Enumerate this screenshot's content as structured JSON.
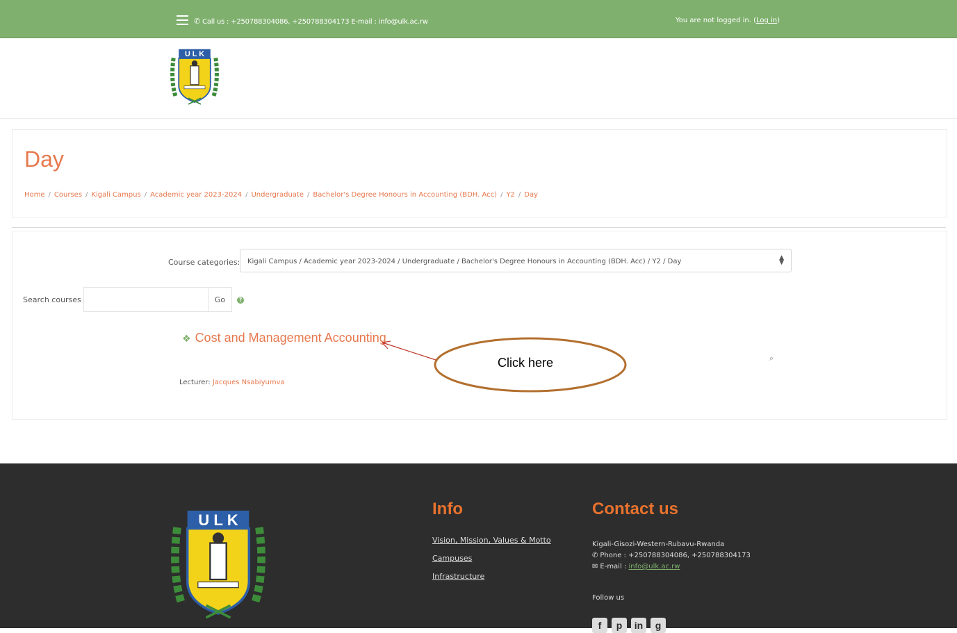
{
  "topbar": {
    "contact_text": "Call us : +250788304086, +250788304173 E-mail : info@ulk.ac.rw",
    "login_text": "You are not logged in. (",
    "login_link": "Log in",
    "login_close": ")"
  },
  "logo": {
    "letters": "U L K"
  },
  "page": {
    "title": "Day",
    "breadcrumb": [
      "Home",
      "Courses",
      "Kigali Campus",
      "Academic year 2023-2024",
      "Undergraduate",
      "Bachelor's Degree Honours in Accounting (BDH. Acc)",
      "Y2",
      "Day"
    ]
  },
  "filters": {
    "category_label": "Course categories:",
    "category_selected": "Kigali Campus / Academic year 2023-2024 / Undergraduate / Bachelor's Degree Honours in Accounting (BDH. Acc) / Y2 / Day",
    "search_label": "Search courses",
    "search_value": "",
    "go_label": "Go"
  },
  "course": {
    "name": "Cost and Management Accounting",
    "lecturer_label": "Lecturer:",
    "lecturer_name": "Jacques Nsabiyumva"
  },
  "annotation": {
    "text": "Click here"
  },
  "footer": {
    "info_title": "Info",
    "info_links": [
      "Vision, Mission, Values & Motto",
      "Campuses",
      "Infrastructure"
    ],
    "contact_title": "Contact us",
    "address": "Kigali-Gisozi-Western-Rubavu-Rwanda",
    "phone_label": "Phone : ",
    "phone": "+250788304086, +250788304173",
    "email_label": "E-mail : ",
    "email": "info@ulk.ac.rw",
    "follow_label": "Follow us"
  },
  "colors": {
    "accent_green": "#7fb06e",
    "accent_orange": "#e7794e",
    "footer_bg": "#2d2d2d",
    "annotation_brown": "#b3702f"
  }
}
